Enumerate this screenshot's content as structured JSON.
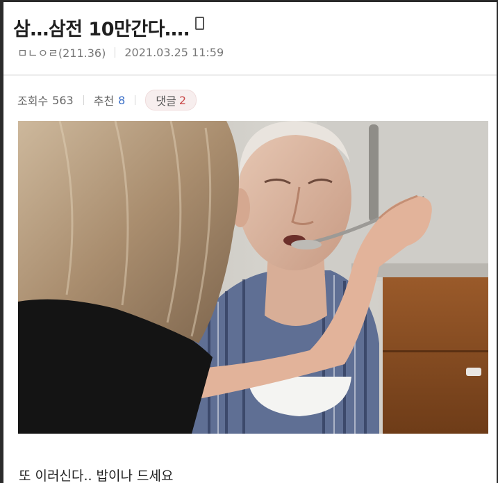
{
  "post": {
    "title": "삼…삼전 10만간다….",
    "author": "ㅁㄴㅇㄹ(211.36)",
    "date": "2021.03.25 11:59",
    "stats": {
      "views_label": "조회수",
      "views": "563",
      "recommend_label": "추천",
      "recommend": "8",
      "comments_label": "댓글",
      "comments": "2"
    },
    "caption": "또 이러신다.. 밥이나 드세요"
  },
  "icons": {
    "title_icon": "mobile-phone-icon"
  },
  "colors": {
    "accent_blue": "#3b6fc7",
    "comment_red": "#c94a4a",
    "comment_pill_bg": "#f7eeee"
  }
}
